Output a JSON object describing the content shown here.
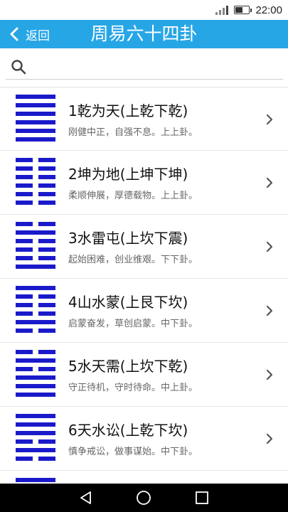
{
  "status_bar": {
    "time": "22:00",
    "battery_level": 0.55,
    "signal_bars": 4
  },
  "header": {
    "back_label": "返回",
    "title": "周易六十四卦"
  },
  "search": {
    "value": "",
    "placeholder": ""
  },
  "colors": {
    "header": "#27a6e6",
    "hexagram": "#1a1acb"
  },
  "list": [
    {
      "title": "1乾为天(上乾下乾)",
      "subtitle": "刚健中正，自强不息。上上卦。",
      "lines": [
        1,
        1,
        1,
        1,
        1,
        1
      ]
    },
    {
      "title": "2坤为地(上坤下坤)",
      "subtitle": "柔顺伸展，厚德载物。上上卦。",
      "lines": [
        0,
        0,
        0,
        0,
        0,
        0
      ]
    },
    {
      "title": "3水雷屯(上坎下震)",
      "subtitle": "起始困难，创业维艰。下下卦。",
      "lines": [
        0,
        1,
        0,
        0,
        0,
        1
      ]
    },
    {
      "title": "4山水蒙(上艮下坎)",
      "subtitle": "启蒙奋发，草创启蒙。中下卦。",
      "lines": [
        1,
        0,
        0,
        0,
        1,
        0
      ]
    },
    {
      "title": "5水天需(上坎下乾)",
      "subtitle": "守正待机，守时待命。中上卦。",
      "lines": [
        0,
        1,
        0,
        1,
        1,
        1
      ]
    },
    {
      "title": "6天水讼(上乾下坎)",
      "subtitle": "慎争戒讼，做事谋始。中下卦。",
      "lines": [
        1,
        1,
        1,
        0,
        1,
        0
      ]
    },
    {
      "title": "",
      "subtitle": "",
      "lines": [
        1,
        1,
        1,
        0,
        0,
        0
      ]
    }
  ]
}
